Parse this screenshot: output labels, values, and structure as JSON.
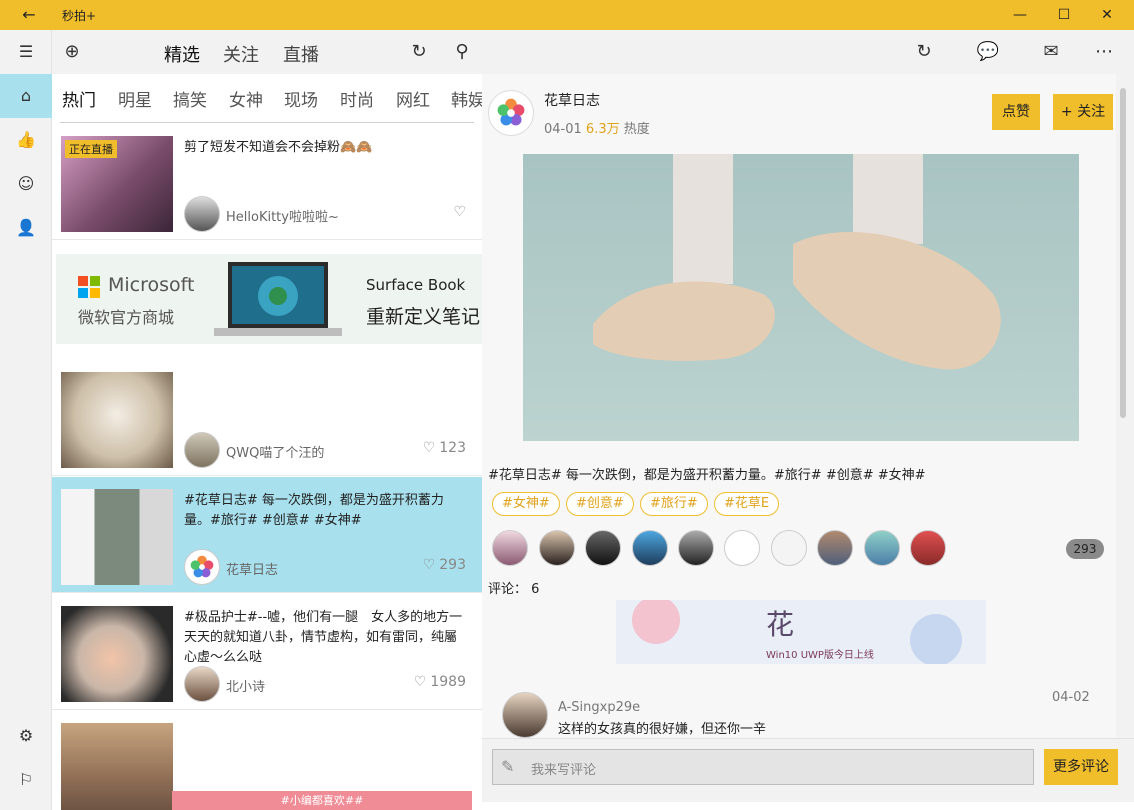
{
  "app": {
    "title": "秒拍+"
  },
  "window_controls": {
    "minimize": "—",
    "maximize": "☐",
    "close": "✕"
  },
  "nav": {
    "back_glyph": "←"
  },
  "top_tabs": [
    {
      "label": "精选",
      "selected": true
    },
    {
      "label": "关注",
      "selected": false
    },
    {
      "label": "直播",
      "selected": false
    }
  ],
  "categories": [
    {
      "label": "热门",
      "selected": true
    },
    {
      "label": "明星"
    },
    {
      "label": "搞笑"
    },
    {
      "label": "女神"
    },
    {
      "label": "现场"
    },
    {
      "label": "时尚"
    },
    {
      "label": "网红"
    },
    {
      "label": "韩娱"
    }
  ],
  "rail": {
    "icons": [
      "menu-icon",
      "home-icon",
      "thumbs-up-icon",
      "emoji-icon",
      "person-icon",
      "settings-icon",
      "flag-icon"
    ]
  },
  "feed": {
    "posts": [
      {
        "text": "剪了短发不知道会不会掉粉🙈🙈",
        "author": "HelloKitty啦啦啦~",
        "likes": "",
        "badge": "正在直播",
        "active": false
      },
      {
        "text": "",
        "author": "QWQ喵了个汪的",
        "likes": "123",
        "active": false
      },
      {
        "text": "#花草日志# 每一次跌倒，都是为盛开积蓄力量。#旅行# #创意# #女神#",
        "author": "花草日志",
        "likes": "293",
        "active": true
      },
      {
        "text": "#极品护士#--嘘，他们有一腿　女人多的地方一天天的就知道八卦，情节虚构，如有雷同，纯屬心虚～么么哒",
        "author": "北小诗",
        "likes": "1989",
        "active": false
      }
    ],
    "bottom_strip": "#小编都喜欢##"
  },
  "ad": {
    "brand": "Microsoft",
    "store": "微软官方商城",
    "product": "Surface Book",
    "tagline": "重新定义笔记"
  },
  "detail": {
    "author": "花草日志",
    "date": "04-01",
    "heat_value": "6.3万",
    "heat_label": "热度",
    "like_button": "点赞",
    "follow_button": "+ 关注",
    "caption": "#花草日志# 每一次跌倒，都是为盛开积蓄力量。#旅行# #创意# #女神#",
    "tags": [
      "#女神#",
      "#创意#",
      "#旅行#",
      "#花草E"
    ],
    "like_count": "293",
    "comments_label": "评论：",
    "comments_count": "6",
    "banner_text": "Win10 UWP版今日上线",
    "first_comment": {
      "author": "A-Singxp29e",
      "date": "04-02",
      "text": "这样的女孩真的很好嫌，但还你一辛"
    }
  },
  "comment_bar": {
    "placeholder": "我来写评论",
    "more_button": "更多评论"
  },
  "colors": {
    "accent": "#f0bd2b",
    "active_row": "#a8e0ed",
    "hot": "#e0a21a"
  }
}
